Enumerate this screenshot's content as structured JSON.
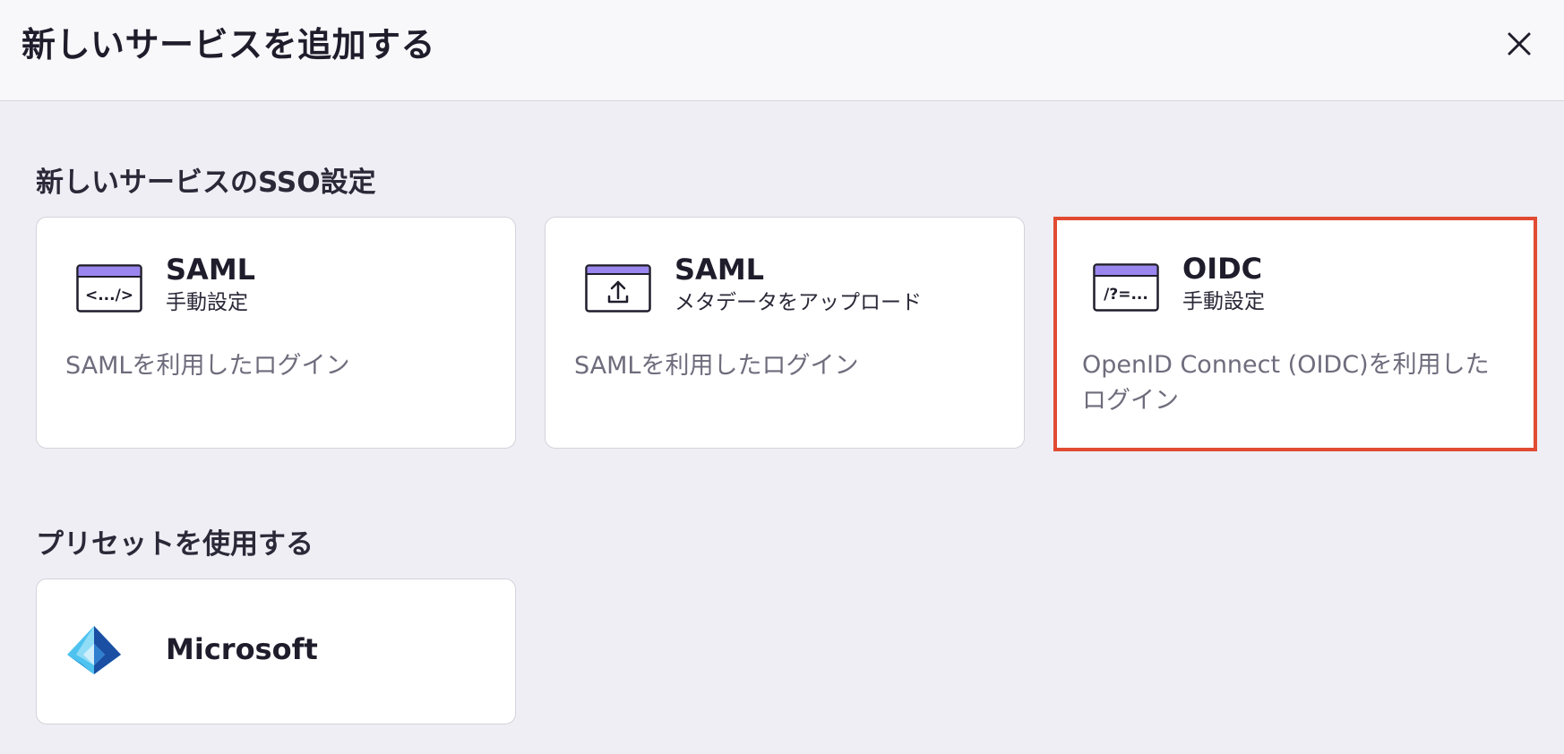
{
  "header": {
    "title": "新しいサービスを追加する",
    "close_icon": "close-icon"
  },
  "sso_section": {
    "title": "新しいサービスのSSO設定",
    "cards": [
      {
        "icon": "code-window-icon",
        "icon_text": "<.../>",
        "title": "SAML",
        "subtitle": "手動設定",
        "description": "SAMLを利用したログイン",
        "selected": false
      },
      {
        "icon": "upload-window-icon",
        "title": "SAML",
        "subtitle": "メタデータをアップロード",
        "description": "SAMLを利用したログイン",
        "selected": false
      },
      {
        "icon": "query-window-icon",
        "icon_text": "/?=...",
        "title": "OIDC",
        "subtitle": "手動設定",
        "description": "OpenID Connect (OIDC)を利用したログイン",
        "selected": true
      }
    ]
  },
  "preset_section": {
    "title": "プリセットを使用する",
    "presets": [
      {
        "icon": "microsoft-entra-icon",
        "name": "Microsoft"
      }
    ]
  },
  "colors": {
    "accent_purple": "#9b86f0",
    "selected_border": "#e14b32",
    "background": "#efeef4",
    "header_bg": "#f8f8fb"
  }
}
